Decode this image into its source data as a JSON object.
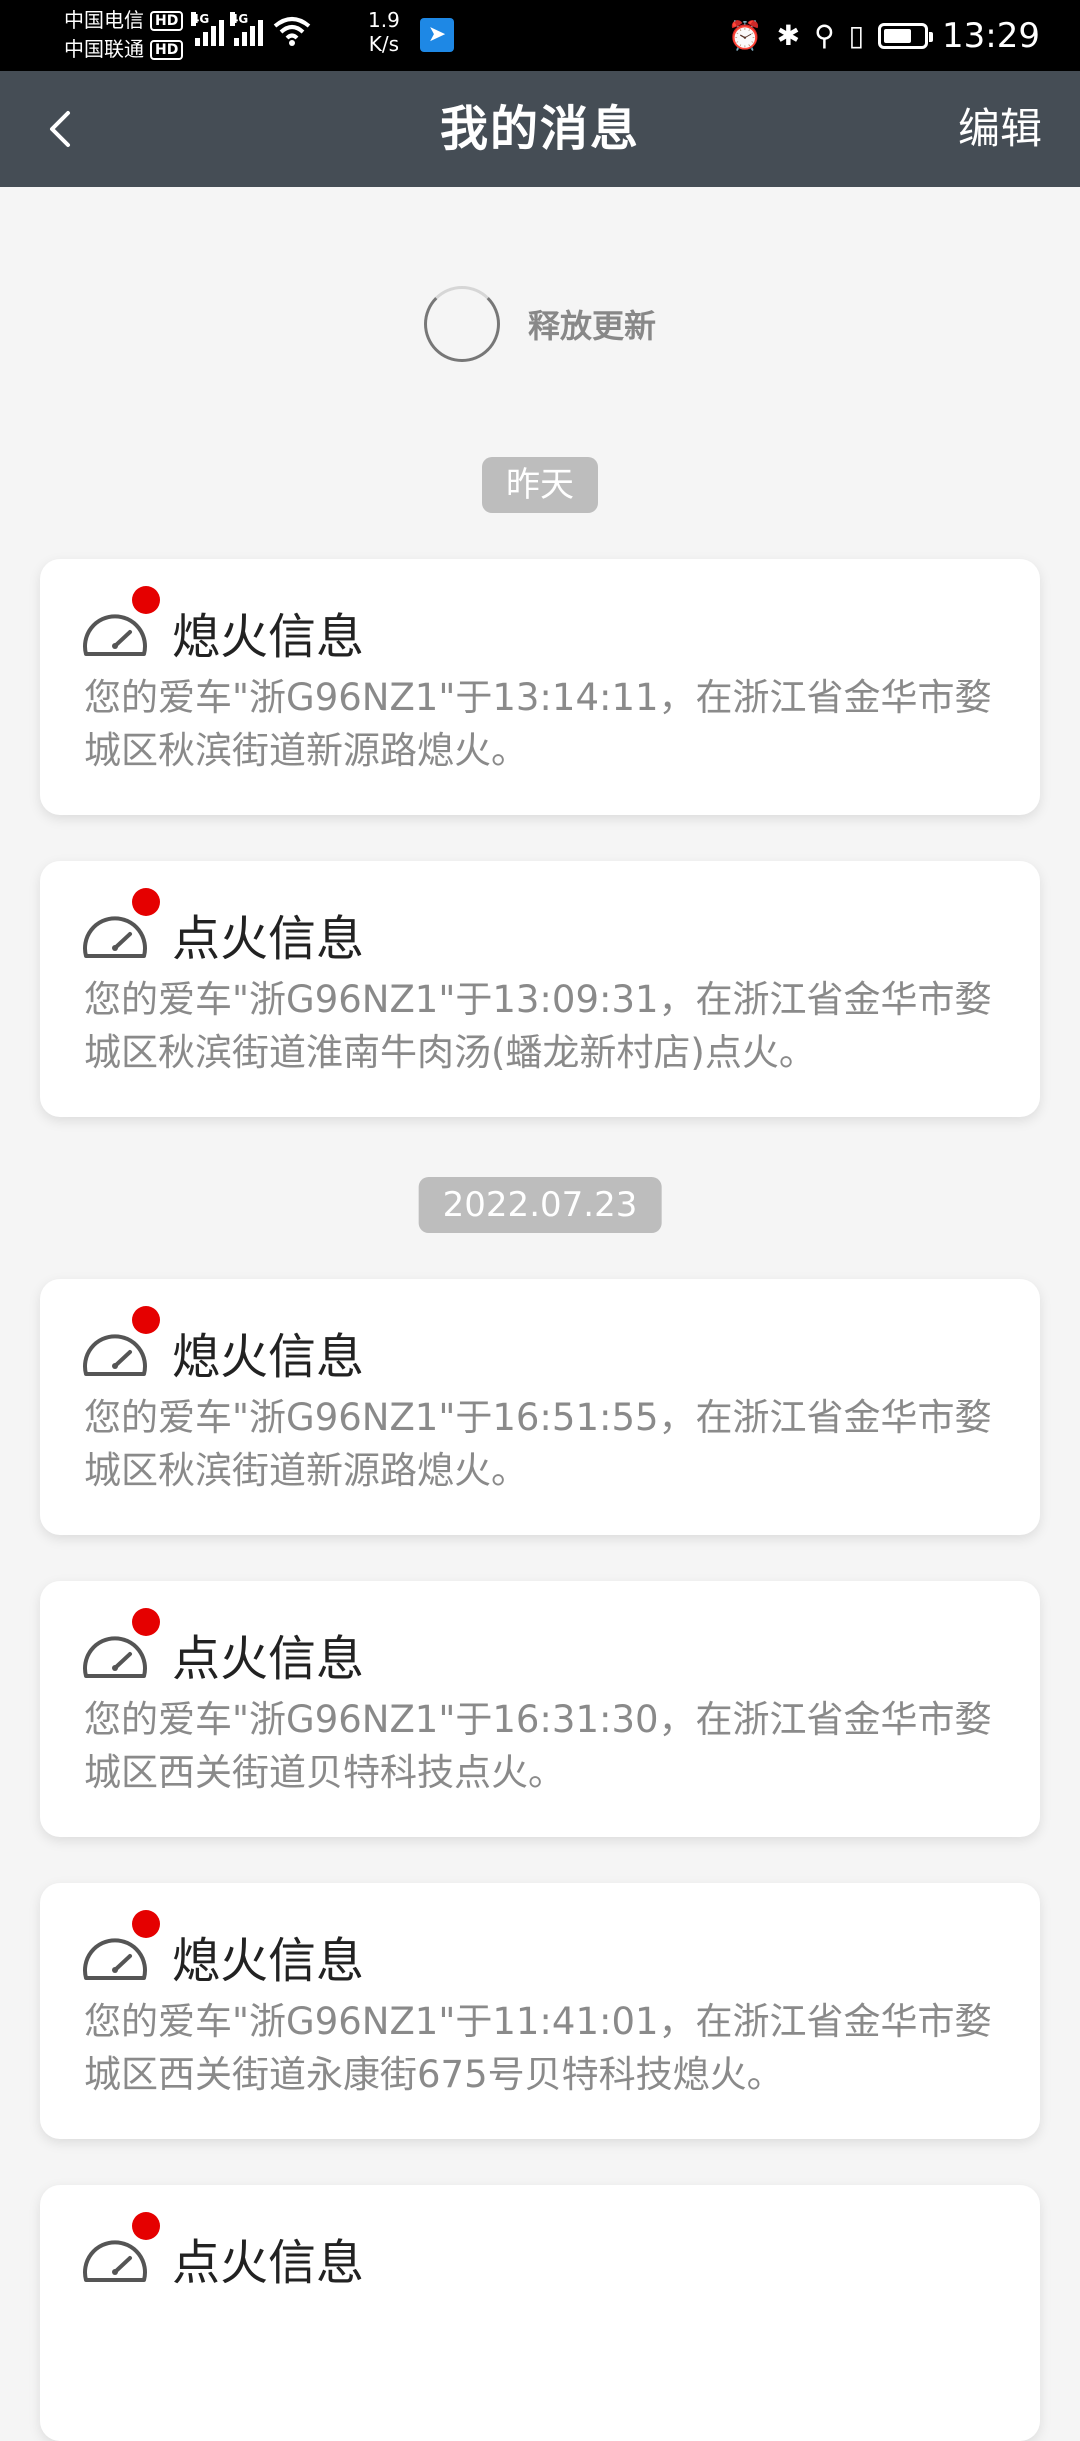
{
  "status_bar": {
    "carrier1": "中国电信",
    "carrier2": "中国联通",
    "hd_badge": "HD",
    "network": "4G",
    "speed_value": "1.9",
    "speed_unit": "K/s",
    "time": "13:29",
    "battery_level": 0.75
  },
  "header": {
    "back_icon": "‹",
    "title": "我的消息",
    "edit_label": "编辑"
  },
  "refresh_text": "释放更新",
  "groups": [
    {
      "date": "昨天"
    },
    {
      "date": "2022.07.23"
    }
  ],
  "messages": [
    {
      "title": "熄火信息",
      "text": "您的爱车\"浙G96NZ1\"于13:14:11，在浙江省金华市婺城区秋滨街道新源路熄火。"
    },
    {
      "title": "点火信息",
      "text": "您的爱车\"浙G96NZ1\"于13:09:31，在浙江省金华市婺城区秋滨街道淮南牛肉汤(蟠龙新村店)点火。"
    },
    {
      "title": "熄火信息",
      "text": "您的爱车\"浙G96NZ1\"于16:51:55，在浙江省金华市婺城区秋滨街道新源路熄火。"
    },
    {
      "title": "点火信息",
      "text": "您的爱车\"浙G96NZ1\"于16:31:30，在浙江省金华市婺城区西关街道贝特科技点火。"
    },
    {
      "title": "熄火信息",
      "text": "您的爱车\"浙G96NZ1\"于11:41:01，在浙江省金华市婺城区西关街道永康街675号贝特科技熄火。"
    },
    {
      "title": "点火信息",
      "text": ""
    }
  ],
  "colors": {
    "header_bg": "#454d55",
    "unread_dot": "#e50000",
    "date_chip": "#bdbdbd"
  }
}
